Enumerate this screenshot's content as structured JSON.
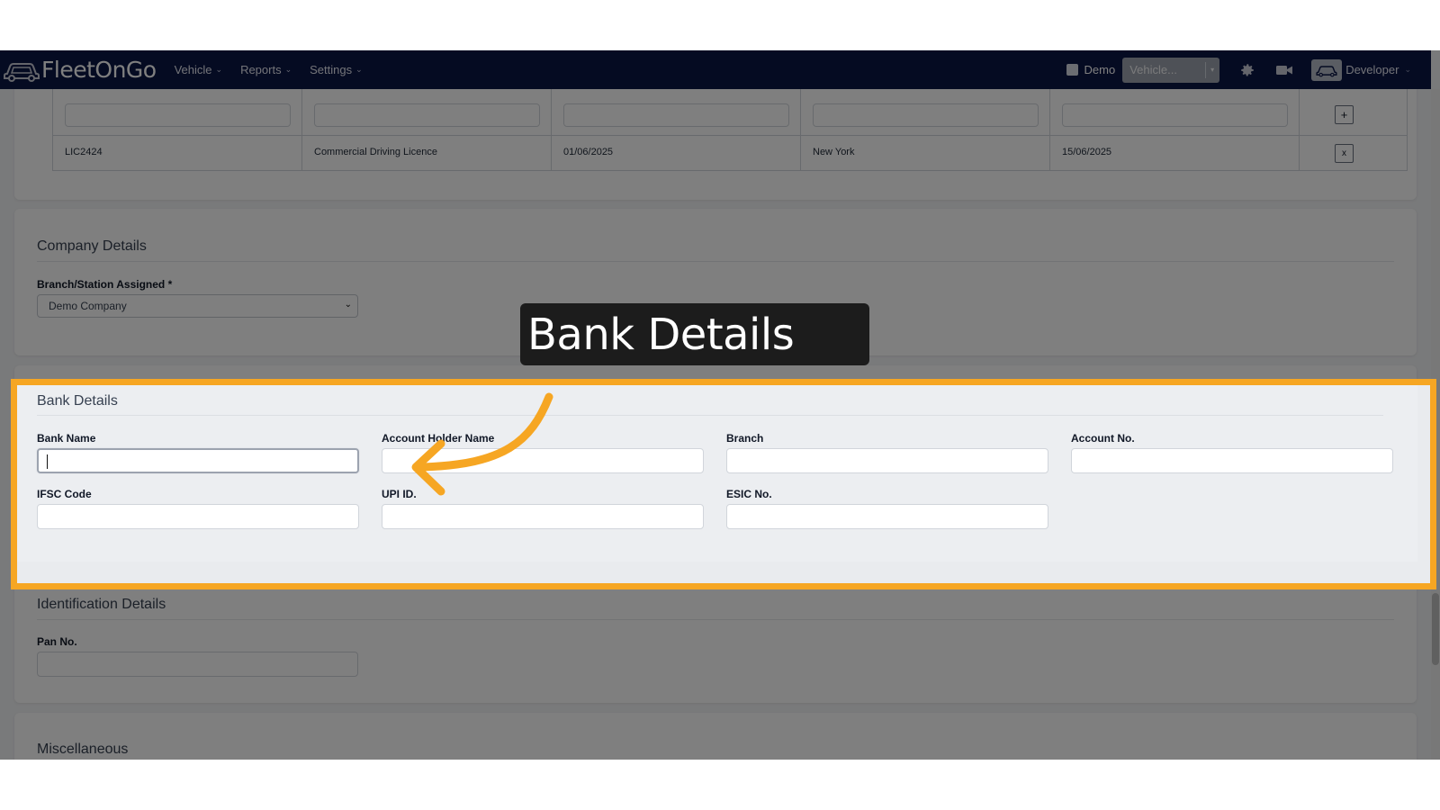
{
  "app": {
    "logo_text": "FleetOnGo",
    "nav": [
      {
        "label": "Vehicle"
      },
      {
        "label": "Reports"
      },
      {
        "label": "Settings"
      }
    ],
    "demo_label": "Demo",
    "vehicle_select": "Vehicle...",
    "user_label": "Developer",
    "accent": "#0b1645"
  },
  "licences": {
    "row": [
      "LIC2424",
      "Commercial Driving Licence",
      "01/06/2025",
      "New York",
      "15/06/2025"
    ],
    "add_symbol": "+",
    "remove_symbol": "x"
  },
  "company": {
    "title": "Company Details",
    "branch_label": "Branch/Station Assigned *",
    "branch_value": "Demo Company"
  },
  "bank": {
    "title": "Bank Details",
    "fields": [
      {
        "label": "Bank Name",
        "value": ""
      },
      {
        "label": "Account Holder Name",
        "value": ""
      },
      {
        "label": "Branch",
        "value": ""
      },
      {
        "label": "Account No.",
        "value": ""
      },
      {
        "label": "IFSC Code",
        "value": ""
      },
      {
        "label": "UPI ID.",
        "value": ""
      },
      {
        "label": "ESIC No.",
        "value": ""
      }
    ],
    "highlight_color": "#f6a623"
  },
  "identification": {
    "title": "Identification Details",
    "pan_label": "Pan No."
  },
  "misc": {
    "title": "Miscellaneous"
  },
  "callout": {
    "text": "Bank Details"
  }
}
